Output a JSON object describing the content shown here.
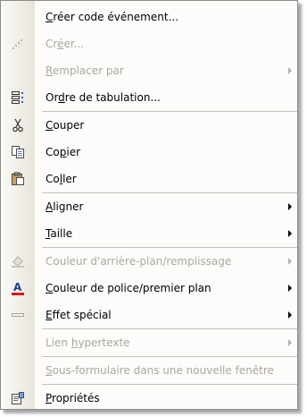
{
  "menu": {
    "items": [
      {
        "id": "create-event-code",
        "icon": "",
        "pre": "",
        "u": "C",
        "post": "réer code événement...",
        "disabled": false,
        "arrow": false,
        "sep_after": false
      },
      {
        "id": "create",
        "icon": "create-wand-icon",
        "pre": "Cr",
        "u": "é",
        "post": "er...",
        "disabled": true,
        "arrow": false,
        "sep_after": false
      },
      {
        "id": "replace-with",
        "icon": "",
        "pre": "",
        "u": "R",
        "post": "emplacer par",
        "disabled": true,
        "arrow": true,
        "sep_after": false
      },
      {
        "id": "tab-order",
        "icon": "tab-order-icon",
        "pre": "Or",
        "u": "d",
        "post": "re de tabulation...",
        "disabled": false,
        "arrow": false,
        "sep_after": true
      },
      {
        "id": "cut",
        "icon": "scissors-icon",
        "pre": "",
        "u": "C",
        "post": "ouper",
        "disabled": false,
        "arrow": false,
        "sep_after": false
      },
      {
        "id": "copy",
        "icon": "copy-icon",
        "pre": "Co",
        "u": "p",
        "post": "ier",
        "disabled": false,
        "arrow": false,
        "sep_after": false
      },
      {
        "id": "paste",
        "icon": "paste-icon",
        "pre": "Co",
        "u": "l",
        "post": "ler",
        "disabled": false,
        "arrow": false,
        "sep_after": true
      },
      {
        "id": "align",
        "icon": "",
        "pre": "",
        "u": "A",
        "post": "ligner",
        "disabled": false,
        "arrow": true,
        "sep_after": false
      },
      {
        "id": "size",
        "icon": "",
        "pre": "",
        "u": "T",
        "post": "aille",
        "disabled": false,
        "arrow": true,
        "sep_after": true
      },
      {
        "id": "back-fill-color",
        "icon": "fill-color-icon",
        "pre": "Couleur d'arrière-plan/remplissage",
        "u": "",
        "post": "",
        "disabled": true,
        "arrow": true,
        "sep_after": false
      },
      {
        "id": "font-color",
        "icon": "font-color-icon",
        "pre": "",
        "u": "C",
        "post": "ouleur de police/premier plan",
        "disabled": false,
        "arrow": true,
        "sep_after": false
      },
      {
        "id": "special-effect",
        "icon": "special-effect-icon",
        "pre": "",
        "u": "E",
        "post": "ffet spécial",
        "disabled": false,
        "arrow": true,
        "sep_after": true
      },
      {
        "id": "hyperlink",
        "icon": "",
        "pre": "Lien ",
        "u": "h",
        "post": "ypertexte",
        "disabled": true,
        "arrow": true,
        "sep_after": true
      },
      {
        "id": "subform-new-window",
        "icon": "",
        "pre": "",
        "u": "S",
        "post": "ous-formulaire dans une nouvelle fenêtre",
        "disabled": true,
        "arrow": false,
        "sep_after": true
      },
      {
        "id": "properties",
        "icon": "properties-icon",
        "pre": "",
        "u": "P",
        "post": "ropriétés",
        "disabled": false,
        "arrow": false,
        "sep_after": false
      }
    ]
  }
}
